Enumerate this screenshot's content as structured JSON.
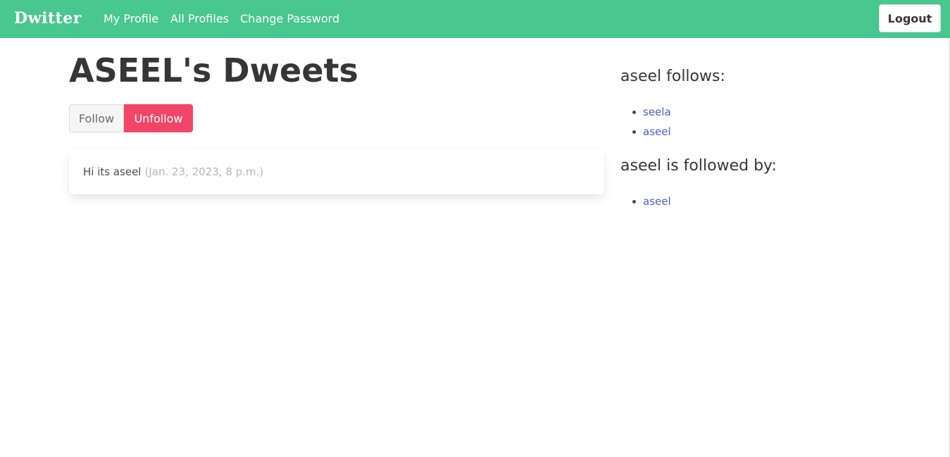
{
  "navbar": {
    "brand": "Dwitter",
    "links": [
      {
        "label": "My Profile"
      },
      {
        "label": "All Profiles"
      },
      {
        "label": "Change Password"
      }
    ],
    "logout_label": "Logout",
    "color": "#48c78e"
  },
  "profile": {
    "title": "ASEEL's Dweets",
    "follow_label": "Follow",
    "unfollow_label": "Unfollow"
  },
  "dweets": [
    {
      "body": "Hi its aseel",
      "date": "(Jan. 23, 2023, 8 p.m.)"
    }
  ],
  "sidebar": {
    "follows_heading": "aseel follows:",
    "follows": [
      "seela",
      "aseel"
    ],
    "followed_by_heading": "aseel is followed by:",
    "followed_by": [
      "aseel"
    ]
  },
  "colors": {
    "accent": "#48c78e",
    "danger": "#f14668",
    "link": "#485fc7"
  }
}
